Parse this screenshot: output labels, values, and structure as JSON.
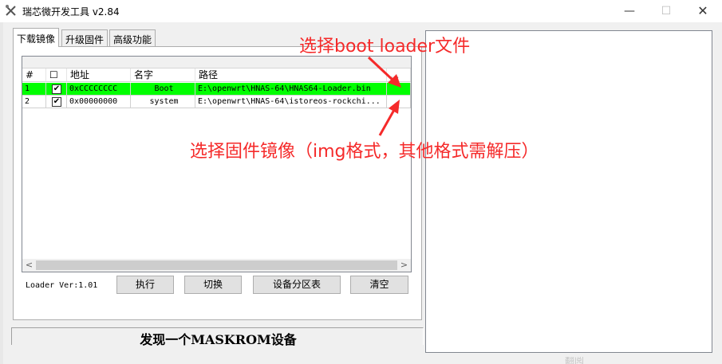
{
  "window": {
    "title": "瑞芯微开发工具 v2.84",
    "minimize_glyph": "—",
    "maximize_glyph": "☐",
    "close_glyph": "✕"
  },
  "tabs": [
    {
      "label": "下载镜像",
      "active": true
    },
    {
      "label": "升级固件",
      "active": false
    },
    {
      "label": "高级功能",
      "active": false
    }
  ],
  "table": {
    "columns": [
      "#",
      "☐",
      "地址",
      "名字",
      "路径",
      "..."
    ],
    "rows": [
      {
        "num": "1",
        "checked": "✔",
        "address": "0xCCCCCCCC",
        "name": "Boot",
        "path": "E:\\openwrt\\HNAS-64\\HNAS64-Loader.bin",
        "highlight": "#00ff00"
      },
      {
        "num": "2",
        "checked": "✔",
        "address": "0x00000000",
        "name": "system",
        "path": "E:\\openwrt\\HNAS-64\\istoreos-rockchi...",
        "highlight": "#ffffff"
      }
    ],
    "scroll_left": "<",
    "scroll_right": ">"
  },
  "loader_version": "Loader Ver:1.01",
  "buttons": {
    "execute": "执行",
    "switch": "切换",
    "partition_table": "设备分区表",
    "clear": "清空"
  },
  "status": "发现一个MASKROM设备",
  "annotations": {
    "boot_loader": "选择boot loader文件",
    "firmware_image": "选择固件镜像（img格式，其他格式需解压）",
    "color": "#f52a2a"
  },
  "bottom_fragment": "翻阅"
}
